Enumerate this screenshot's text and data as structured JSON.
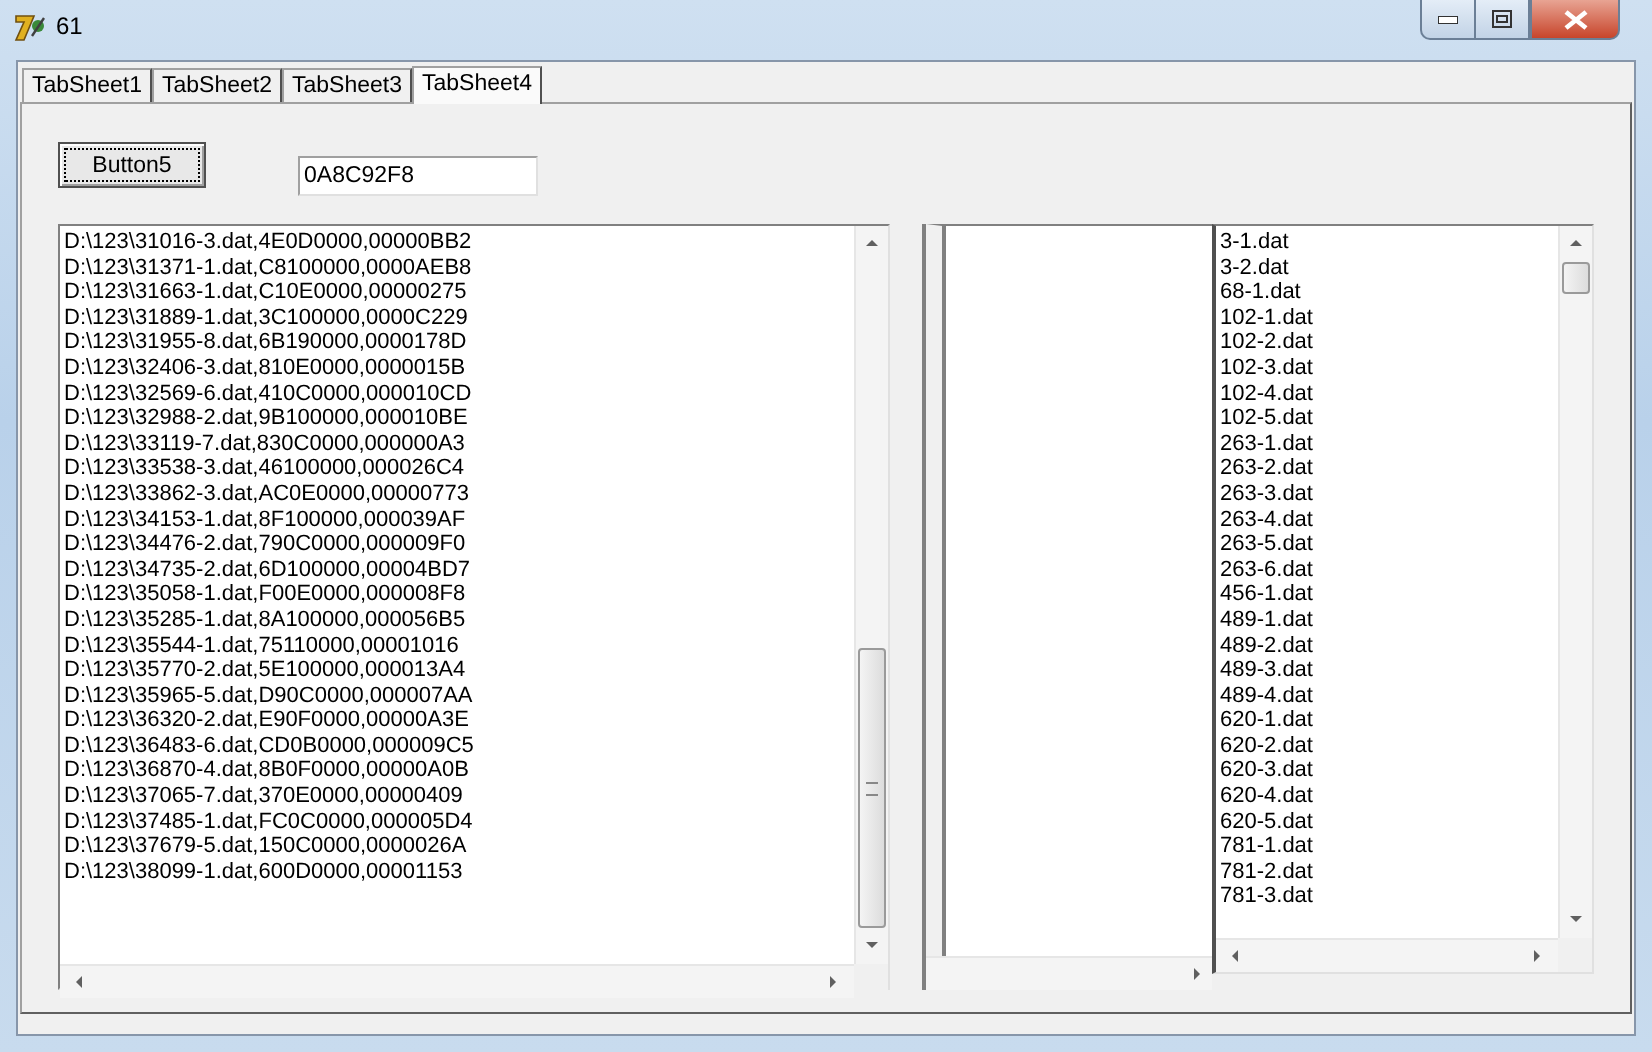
{
  "window": {
    "title": "61"
  },
  "tabs": [
    {
      "label": "TabSheet1",
      "selected": false
    },
    {
      "label": "TabSheet2",
      "selected": false
    },
    {
      "label": "TabSheet3",
      "selected": false
    },
    {
      "label": "TabSheet4",
      "selected": true
    }
  ],
  "button": {
    "label": "Button5"
  },
  "field": {
    "value": "0A8C92F8"
  },
  "left_list": {
    "items": [
      "D:\\123\\31016-3.dat,4E0D0000,00000BB2",
      "D:\\123\\31371-1.dat,C8100000,0000AEB8",
      "D:\\123\\31663-1.dat,C10E0000,00000275",
      "D:\\123\\31889-1.dat,3C100000,0000C229",
      "D:\\123\\31955-8.dat,6B190000,0000178D",
      "D:\\123\\32406-3.dat,810E0000,0000015B",
      "D:\\123\\32569-6.dat,410C0000,000010CD",
      "D:\\123\\32988-2.dat,9B100000,000010BE",
      "D:\\123\\33119-7.dat,830C0000,000000A3",
      "D:\\123\\33538-3.dat,46100000,000026C4",
      "D:\\123\\33862-3.dat,AC0E0000,00000773",
      "D:\\123\\34153-1.dat,8F100000,000039AF",
      "D:\\123\\34476-2.dat,790C0000,000009F0",
      "D:\\123\\34735-2.dat,6D100000,00004BD7",
      "D:\\123\\35058-1.dat,F00E0000,000008F8",
      "D:\\123\\35285-1.dat,8A100000,000056B5",
      "D:\\123\\35544-1.dat,75110000,00001016",
      "D:\\123\\35770-2.dat,5E100000,000013A4",
      "D:\\123\\35965-5.dat,D90C0000,000007AA",
      "D:\\123\\36320-2.dat,E90F0000,00000A3E",
      "D:\\123\\36483-6.dat,CD0B0000,000009C5",
      "D:\\123\\36870-4.dat,8B0F0000,00000A0B",
      "D:\\123\\37065-7.dat,370E0000,00000409",
      "D:\\123\\37485-1.dat,FC0C0000,000005D4",
      "D:\\123\\37679-5.dat,150C0000,0000026A",
      "D:\\123\\38099-1.dat,600D0000,00001153"
    ]
  },
  "right_list": {
    "items": [
      "3-1.dat",
      "3-2.dat",
      "68-1.dat",
      "102-1.dat",
      "102-2.dat",
      "102-3.dat",
      "102-4.dat",
      "102-5.dat",
      "263-1.dat",
      "263-2.dat",
      "263-3.dat",
      "263-4.dat",
      "263-5.dat",
      "263-6.dat",
      "456-1.dat",
      "489-1.dat",
      "489-2.dat",
      "489-3.dat",
      "489-4.dat",
      "620-1.dat",
      "620-2.dat",
      "620-3.dat",
      "620-4.dat",
      "620-5.dat",
      "781-1.dat",
      "781-2.dat",
      "781-3.dat"
    ]
  }
}
